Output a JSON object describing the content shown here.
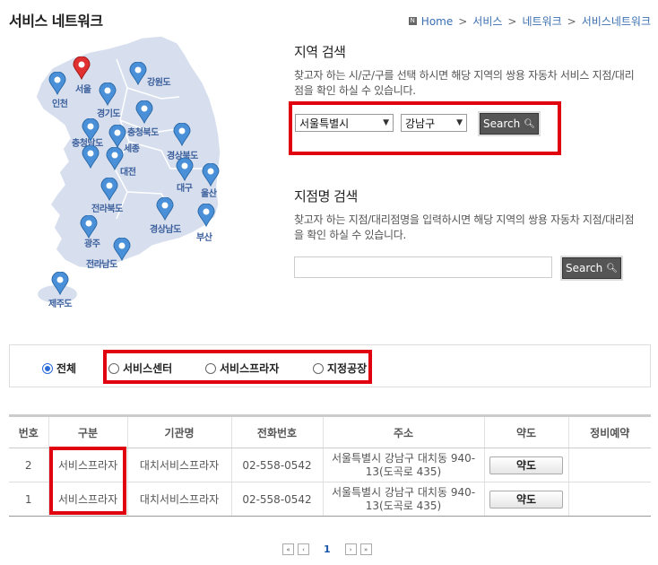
{
  "header": {
    "title": "서비스 네트워크",
    "breadcrumb": [
      "Home",
      "서비스",
      "네트워크",
      "서비스네트워크"
    ]
  },
  "map": {
    "cities": [
      {
        "name": "서울",
        "selected": true
      },
      {
        "name": "인천"
      },
      {
        "name": "강원도"
      },
      {
        "name": "경기도"
      },
      {
        "name": "충청북도"
      },
      {
        "name": "충청남도"
      },
      {
        "name": "세종"
      },
      {
        "name": "대전"
      },
      {
        "name": "경상북도"
      },
      {
        "name": "대구"
      },
      {
        "name": "울산"
      },
      {
        "name": "전라북도"
      },
      {
        "name": "경상남도"
      },
      {
        "name": "부산"
      },
      {
        "name": "광주"
      },
      {
        "name": "전라남도"
      },
      {
        "name": "제주도"
      }
    ]
  },
  "region_search": {
    "title": "지역 검색",
    "description": "찾고자 하는 시/군/구를 선택 하시면 해당 지역의 쌍용 자동차 서비스 지점/대리점을 확인 하실 수 있습니다.",
    "city_select": "서울특별시",
    "district_select": "강남구",
    "button": "Search"
  },
  "branch_search": {
    "title": "지점명 검색",
    "description": "찾고자 하는 지점/대리점명을 입력하시면 해당 지역의 쌍용 자동차 지점/대리점을 확인 하실 수 있습니다.",
    "input_value": "",
    "button": "Search"
  },
  "filters": {
    "options": [
      "전체",
      "서비스센터",
      "서비스프라자",
      "지정공장"
    ],
    "selected": "전체"
  },
  "table": {
    "headers": [
      "번호",
      "구분",
      "기관명",
      "전화번호",
      "주소",
      "약도",
      "정비예약"
    ],
    "rows": [
      {
        "no": "2",
        "type": "서비스프라자",
        "name": "대치서비스프라자",
        "phone": "02-558-0542",
        "address": "서울특별시 강남구 대치동 940-13(도곡로 435)",
        "map": "약도",
        "reserve": ""
      },
      {
        "no": "1",
        "type": "서비스프라자",
        "name": "대치서비스프라자",
        "phone": "02-558-0542",
        "address": "서울특별시 강남구 대치동 940-13(도곡로 435)",
        "map": "약도",
        "reserve": ""
      }
    ]
  },
  "pagination": {
    "current": "1",
    "icons": [
      "first-page-icon",
      "prev-page-icon",
      "next-page-icon",
      "last-page-icon"
    ]
  },
  "colors": {
    "highlight": "#e0000f",
    "pin": "#4a90d9",
    "pin_selected": "#e03030",
    "map_fill": "#d7dfee",
    "link": "#3a6fb0"
  }
}
